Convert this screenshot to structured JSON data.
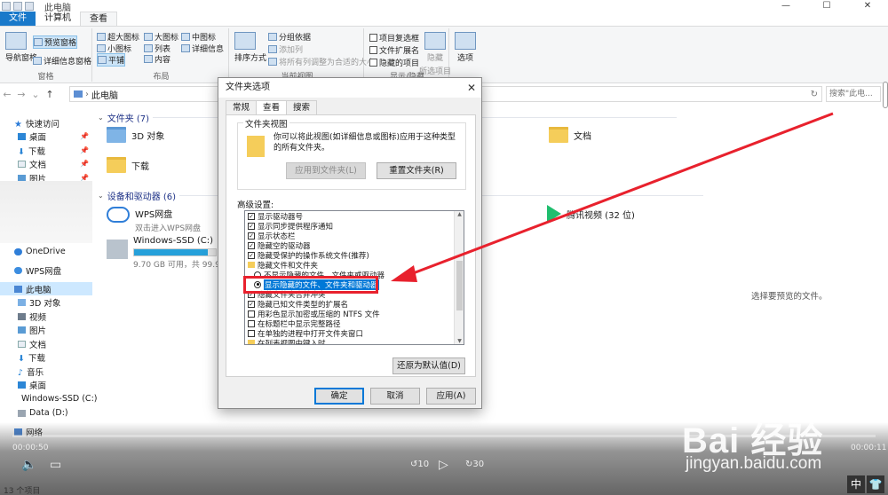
{
  "window": {
    "title": "此电脑",
    "minimize": "—",
    "maximize": "☐",
    "close": "✕"
  },
  "ribbon": {
    "tabs": [
      "文件",
      "计算机",
      "查看"
    ],
    "groups": {
      "panes": {
        "label": "窗格",
        "nav_pane": "导航窗格",
        "preview_pane": "预览窗格",
        "details_pane": "详细信息窗格"
      },
      "layout": {
        "label": "布局",
        "xl_icons": "超大图标",
        "large_icons": "大图标",
        "medium_icons": "中图标",
        "small_icons": "小图标",
        "list": "列表",
        "details": "详细信息",
        "tiles": "平铺",
        "content": "内容"
      },
      "current_view": {
        "label": "当前视图",
        "sort_by": "排序方式",
        "group_by": "分组依据",
        "add_column": "添加列",
        "size_all_columns": "将所有列调整为合适的大小"
      },
      "show_hide": {
        "label": "显示/隐藏",
        "item_checkboxes": "项目复选框",
        "file_extensions": "文件扩展名",
        "hidden_items": "隐藏的项目",
        "hide_selected": "隐藏",
        "hide_selected_sub": "所选项目"
      },
      "options": {
        "label": "选项"
      }
    }
  },
  "address": {
    "path": "此电脑",
    "search_placeholder": "搜索\"此电..."
  },
  "nav": {
    "quick_access": "快速访问",
    "items": [
      {
        "label": "桌面",
        "pinned": true
      },
      {
        "label": "下载",
        "pinned": true
      },
      {
        "label": "文档",
        "pinned": true
      },
      {
        "label": "图片",
        "pinned": true
      }
    ],
    "onedrive": "OneDrive",
    "wps": "WPS网盘",
    "this_pc": "此电脑",
    "pc_items": [
      "3D 对象",
      "视频",
      "图片",
      "文档",
      "下载",
      "音乐",
      "桌面",
      "Windows-SSD (C:)",
      "Data (D:)"
    ],
    "network": "网络"
  },
  "content": {
    "folders_header": "文件夹 (7)",
    "folders": [
      "3D 对象",
      "文档",
      "下载"
    ],
    "drives_header": "设备和驱动器 (6)",
    "wps_drive": {
      "name": "WPS网盘",
      "sub": "双击进入WPS网盘"
    },
    "c_drive": {
      "name": "Windows-SSD (C:)",
      "sub": "9.70 GB 可用，共 99.9 GB",
      "used_fraction": 0.9
    },
    "tencent": "腾讯视频 (32 位)",
    "preview_hint": "选择要预览的文件。"
  },
  "status": {
    "items": "13 个项目"
  },
  "player": {
    "elapsed": "00:00:50",
    "total": "00:00:11",
    "rewind": "10",
    "forward": "30"
  },
  "ime": [
    "中",
    "👕"
  ],
  "watermark": {
    "brand": "Bai  经验",
    "url": "jingyan.baidu.com"
  },
  "dialog": {
    "title": "文件夹选项",
    "close": "✕",
    "tabs": [
      "常规",
      "查看",
      "搜索"
    ],
    "folder_views": {
      "legend": "文件夹视图",
      "description": "你可以将此视图(如详细信息或图标)应用于这种类型的所有文件夹。",
      "apply_btn": "应用到文件夹(L)",
      "reset_btn": "重置文件夹(R)"
    },
    "advanced_label": "高级设置:",
    "advanced_items": [
      {
        "kind": "check",
        "checked": true,
        "label": "显示驱动器号"
      },
      {
        "kind": "check",
        "checked": true,
        "label": "显示同步提供程序通知"
      },
      {
        "kind": "check",
        "checked": true,
        "label": "显示状态栏"
      },
      {
        "kind": "check",
        "checked": true,
        "label": "隐藏空的驱动器"
      },
      {
        "kind": "check",
        "checked": true,
        "label": "隐藏受保护的操作系统文件(推荐)"
      },
      {
        "kind": "folder",
        "label": "隐藏文件和文件夹"
      },
      {
        "kind": "radio",
        "checked": false,
        "label": "不显示隐藏的文件、文件夹或驱动器"
      },
      {
        "kind": "radio",
        "checked": true,
        "label": "显示隐藏的文件、文件夹和驱动器",
        "highlight": true
      },
      {
        "kind": "check",
        "checked": true,
        "label": "隐藏文件夹合并冲突"
      },
      {
        "kind": "check",
        "checked": true,
        "label": "隐藏已知文件类型的扩展名"
      },
      {
        "kind": "check",
        "checked": false,
        "label": "用彩色显示加密或压缩的 NTFS 文件"
      },
      {
        "kind": "check",
        "checked": false,
        "label": "在标题栏中显示完整路径"
      },
      {
        "kind": "check",
        "checked": false,
        "label": "在单独的进程中打开文件夹窗口"
      },
      {
        "kind": "folder",
        "label": "在列表视图中键入时"
      }
    ],
    "restore_btn": "还原为默认值(D)",
    "ok_btn": "确定",
    "cancel_btn": "取消",
    "apply_btn": "应用(A)"
  },
  "annotation_color": "#e8212d"
}
